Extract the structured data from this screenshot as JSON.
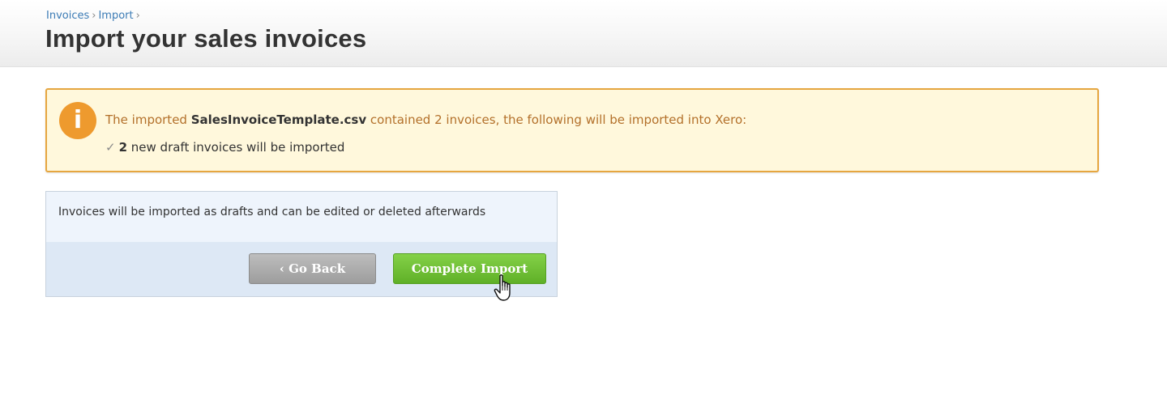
{
  "breadcrumb": {
    "items": [
      "Invoices",
      "Import"
    ],
    "separator": "›"
  },
  "page_title": "Import your sales invoices",
  "notice": {
    "icon": "info-icon",
    "icon_glyph": "i",
    "text_prefix": "The imported ",
    "filename": "SalesInvoiceTemplate.csv",
    "text_suffix": " contained 2 invoices, the following will be imported into Xero:",
    "check_glyph": "✓",
    "result_count": "2",
    "result_text": " new draft invoices will be imported"
  },
  "panel": {
    "description": "Invoices will be imported as drafts and can be edited or deleted afterwards",
    "back_label": "‹ Go Back",
    "complete_label": "Complete Import"
  },
  "colors": {
    "accent_orange": "#e6a640",
    "button_green": "#6cbf33",
    "button_gray": "#a9a9a9",
    "link_blue": "#3b7bb5"
  }
}
